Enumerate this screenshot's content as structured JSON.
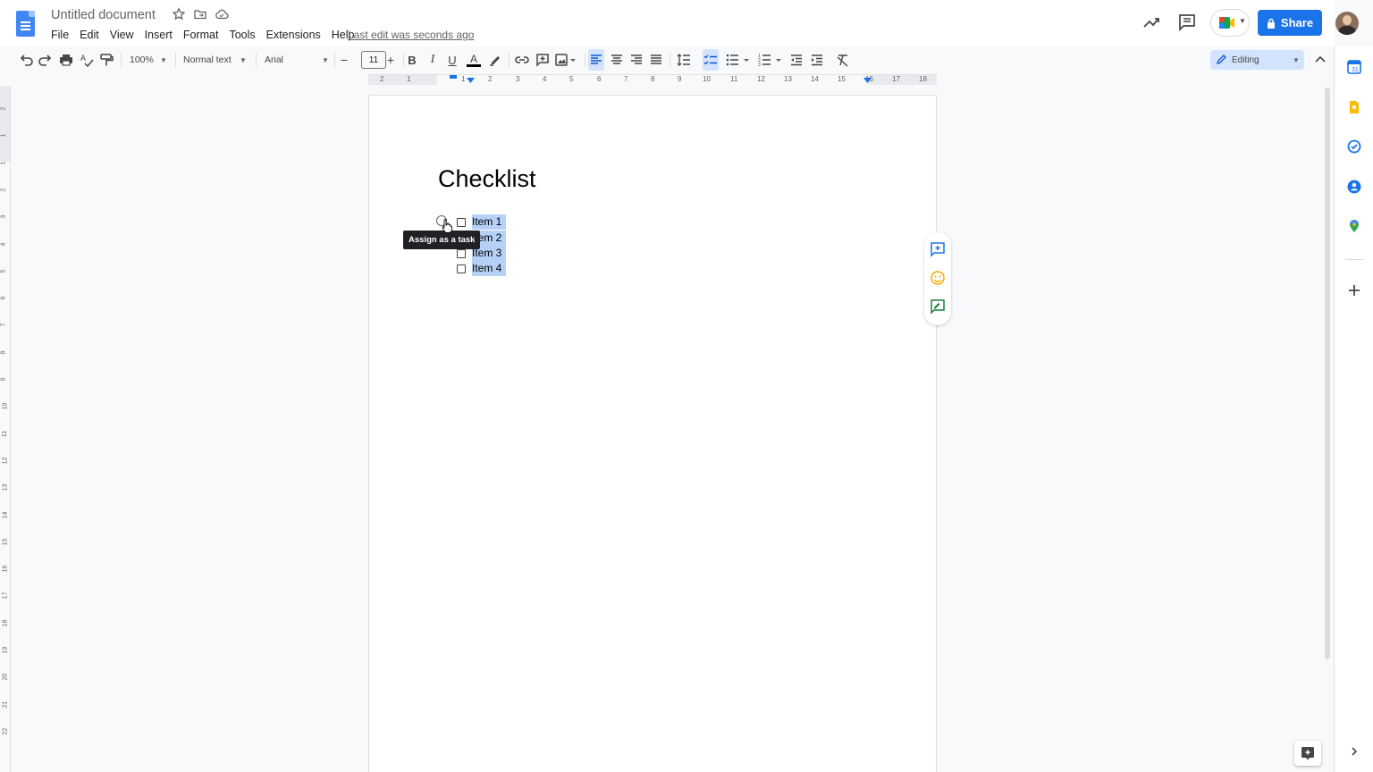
{
  "app": {
    "doc_title": "Untitled document",
    "last_edit": "Last edit was seconds ago",
    "share_label": "Share"
  },
  "menu": [
    "File",
    "Edit",
    "View",
    "Insert",
    "Format",
    "Tools",
    "Extensions",
    "Help"
  ],
  "toolbar": {
    "zoom": "100%",
    "style": "Normal text",
    "font": "Arial",
    "font_size": "11",
    "text_color_icon": "A",
    "editing_mode": "Editing"
  },
  "ruler": {
    "h_ticks": [
      "2",
      "1",
      "1",
      "2",
      "3",
      "4",
      "5",
      "6",
      "7",
      "8",
      "9",
      "10",
      "11",
      "12",
      "13",
      "14",
      "15",
      "16",
      "17",
      "18"
    ],
    "v_ticks": [
      "2",
      "1",
      "1",
      "2",
      "3",
      "4",
      "5",
      "6",
      "7",
      "8",
      "9",
      "10",
      "11",
      "12",
      "13",
      "14",
      "15",
      "16",
      "17",
      "18",
      "19",
      "20",
      "21",
      "22"
    ]
  },
  "document": {
    "heading": "Checklist",
    "items": [
      {
        "label": "Item 1",
        "checked": false
      },
      {
        "label": "Item 2",
        "checked": false
      },
      {
        "label": "Item 3",
        "checked": false
      },
      {
        "label": "Item 4",
        "checked": false
      }
    ],
    "tooltip": "Assign as a task"
  },
  "colors": {
    "accent": "#1a73e8",
    "selection": "#b6d1f7",
    "docs_blue": "#4285f4"
  }
}
